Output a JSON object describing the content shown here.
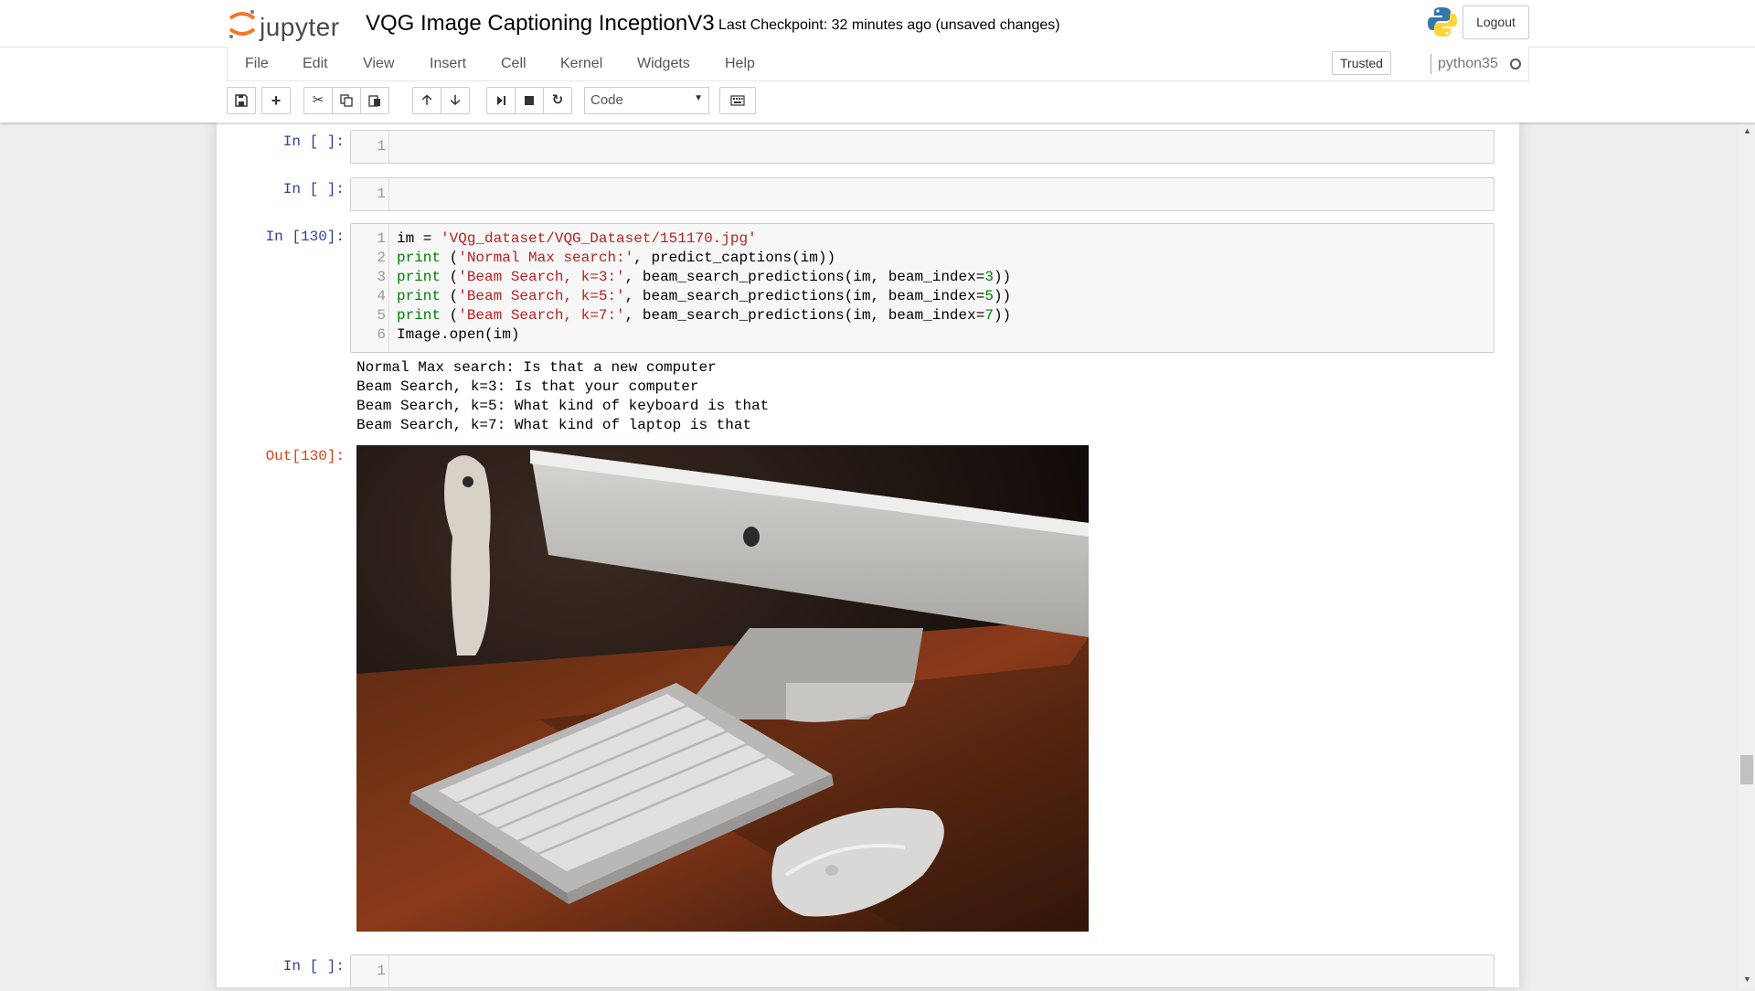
{
  "header": {
    "logo_text": "jupyter",
    "notebook_title": "VQG Image Captioning InceptionV3",
    "checkpoint": "Last Checkpoint: 32 minutes ago (unsaved changes)",
    "logout_label": "Logout"
  },
  "menubar": {
    "items": [
      "File",
      "Edit",
      "View",
      "Insert",
      "Cell",
      "Kernel",
      "Widgets",
      "Help"
    ],
    "trusted_label": "Trusted",
    "kernel_name": "python35"
  },
  "toolbar": {
    "buttons": [
      "save-icon",
      "plus-icon",
      "cut-icon",
      "copy-icon",
      "paste-icon",
      "arrow-up-icon",
      "arrow-down-icon",
      "step-forward-icon",
      "stop-icon",
      "refresh-icon",
      "keyboard-icon"
    ],
    "cell_type": "Code"
  },
  "cells": {
    "c1": {
      "prompt": "In [ ]:",
      "line": "1"
    },
    "c2": {
      "prompt": "In [ ]:",
      "line": "1"
    },
    "c3": {
      "prompt": "In [130]:",
      "lines": [
        "1",
        "2",
        "3",
        "4",
        "5",
        "6"
      ],
      "code": {
        "l1_a": "im = ",
        "l1_b": "'VQg_dataset/VQG_Dataset/151170.jpg'",
        "l2_a": "print",
        "l2_b": " (",
        "l2_c": "'Normal Max search:'",
        "l2_d": ", predict_captions(im))",
        "l3_a": "print",
        "l3_b": " (",
        "l3_c": "'Beam Search, k=3:'",
        "l3_d": ", beam_search_predictions(im, beam_index=",
        "l3_e": "3",
        "l3_f": "))",
        "l4_a": "print",
        "l4_b": " (",
        "l4_c": "'Beam Search, k=5:'",
        "l4_d": ", beam_search_predictions(im, beam_index=",
        "l4_e": "5",
        "l4_f": "))",
        "l5_a": "print",
        "l5_b": " (",
        "l5_c": "'Beam Search, k=7:'",
        "l5_d": ", beam_search_predictions(im, beam_index=",
        "l5_e": "7",
        "l5_f": "))",
        "l6": "Image.open(im)"
      },
      "stdout": [
        "Normal Max search: Is that a new computer",
        "Beam Search, k=3: Is that your computer",
        "Beam Search, k=5: What kind of keyboard is that",
        "Beam Search, k=7: What kind of laptop is that"
      ],
      "out_prompt": "Out[130]:"
    },
    "c4": {
      "prompt": "In [ ]:",
      "line": "1"
    }
  },
  "colors": {
    "in_prompt": "#303f9f",
    "out_prompt": "#d84315",
    "keyword": "#008000",
    "string": "#ba2121",
    "jupyter_orange": "#f37726"
  }
}
